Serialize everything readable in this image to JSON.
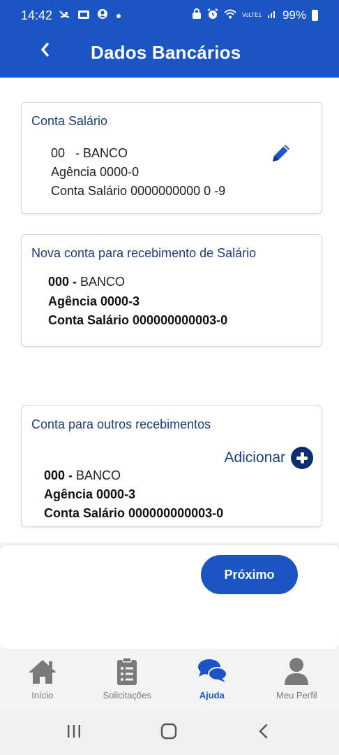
{
  "status_bar": {
    "time": "14:42",
    "battery": "99%",
    "left_icons": [
      "missed-call-icon",
      "sd-card-icon",
      "account-icon",
      "dot-icon"
    ],
    "right_icons": [
      "alarm-lock-icon",
      "alarm-icon",
      "wifi-icon",
      "volte-icon",
      "signal-icon",
      "battery-icon"
    ],
    "volte_label": "VoLTE1"
  },
  "header": {
    "back_icon": "chevron-left-icon",
    "title": "Dados Bancários",
    "color": "#1a55c3"
  },
  "cards": {
    "salary": {
      "title": "Conta Salário",
      "bank_code": "00",
      "bank_name": "- BANCO",
      "agency": "Agência 0000-0",
      "account": "Conta Salário 0000000000 0 -9",
      "edit_icon": "pencil-icon"
    },
    "new_salary": {
      "title": "Nova conta para recebimento de Salário",
      "bank_code": "000 -",
      "bank_name": "BANCO",
      "agency": "Agência 0000-3",
      "account": "Conta Salário 000000000003-0"
    },
    "other": {
      "title": "Conta para outros recebimentos",
      "add_label": "Adicionar",
      "bank_code": "000 -",
      "bank_name": "BANCO",
      "agency": "Agência 0000-3",
      "account": "Conta Salário 000000000003-0"
    }
  },
  "next_button": "Próximo",
  "tabs": [
    {
      "label": "Início",
      "icon": "home-icon",
      "active": false
    },
    {
      "label": "Solicitações",
      "icon": "clipboard-list-icon",
      "active": false
    },
    {
      "label": "Ajuda",
      "icon": "chat-bubbles-icon",
      "active": true
    },
    {
      "label": "Meu Perfil",
      "icon": "user-icon",
      "active": false
    }
  ],
  "colors": {
    "primary": "#1a55c3",
    "dark_blue": "#0b2f6e",
    "inactive": "#7a7a7a"
  }
}
